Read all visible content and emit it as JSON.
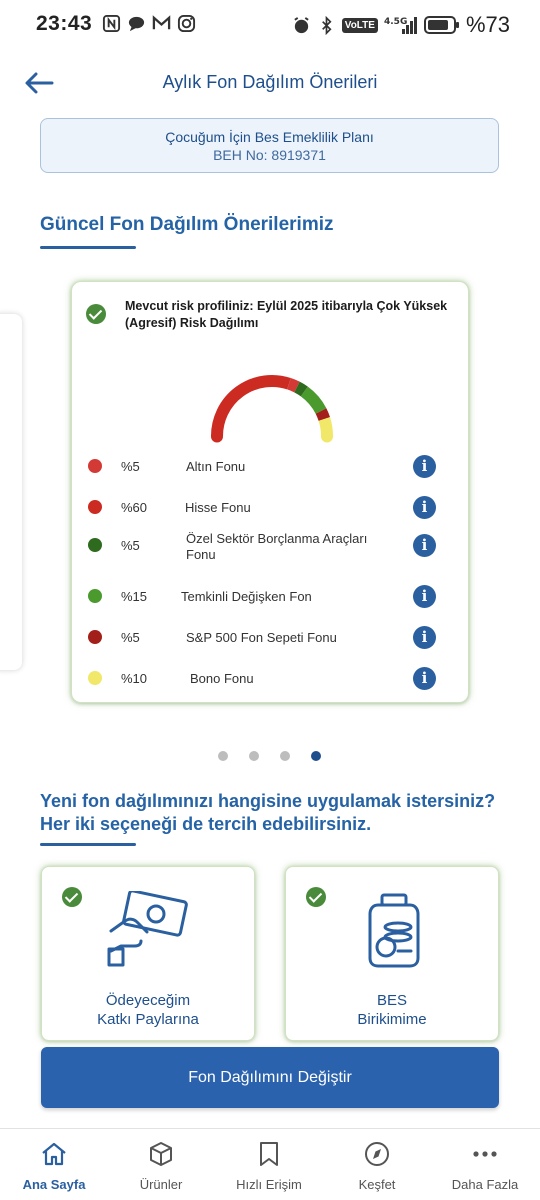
{
  "status_bar": {
    "time": "23:43",
    "network": "VoLTE",
    "network_gen": "4.5G",
    "battery": "%73"
  },
  "header": {
    "title": "Aylık Fon Dağılım Önerileri",
    "back_icon": "arrow-left-icon"
  },
  "plan": {
    "name": "Çocuğum İçin Bes Emeklilik Planı",
    "beh": "BEH No: 8919371"
  },
  "section_title": "Güncel Fon Dağılım Önerilerimiz",
  "risk_card": {
    "description": "Mevcut risk profiliniz: Eylül 2025 itibarıyla Çok Yüksek (Agresif) Risk Dağılımı",
    "funds": [
      {
        "pct": "%5",
        "name": "Altın Fonu",
        "color": "#d43a35",
        "share": 5
      },
      {
        "pct": "%60",
        "name": "Hisse Fonu",
        "color": "#cc2b22",
        "share": 60
      },
      {
        "pct": "%5",
        "name": "Özel Sektör Borçlanma Araçları Fonu",
        "color": "#2e6b1e",
        "share": 5
      },
      {
        "pct": "%15",
        "name": "Temkinli Değişken Fon",
        "color": "#4a9a2e",
        "share": 15
      },
      {
        "pct": "%5",
        "name": "S&P 500 Fon Sepeti Fonu",
        "color": "#a31f1a",
        "share": 5
      },
      {
        "pct": "%10",
        "name": "Bono Fonu",
        "color": "#f1e768",
        "share": 10
      }
    ]
  },
  "pager": {
    "count": 4,
    "active": 4
  },
  "question": "Yeni fon dağılımınızı hangisine uygulamak istersiniz? Her iki seçeneği de tercih edebilirsiniz.",
  "options": [
    {
      "label_line1": "Ödeyeceğim",
      "label_line2": "Katkı Paylarına",
      "icon": "payment-hand-icon"
    },
    {
      "label_line1": "BES",
      "label_line2": "Birikimime",
      "icon": "savings-jar-icon"
    }
  ],
  "primary_button": "Fon Dağılımını Değiştir",
  "nav": [
    {
      "label": "Ana Sayfa",
      "icon": "home-icon",
      "active": true
    },
    {
      "label": "Ürünler",
      "icon": "cube-icon",
      "active": false
    },
    {
      "label": "Hızlı Erişim",
      "icon": "bookmark-icon",
      "active": false
    },
    {
      "label": "Keşfet",
      "icon": "compass-icon",
      "active": false
    },
    {
      "label": "Daha Fazla",
      "icon": "more-icon",
      "active": false
    }
  ]
}
